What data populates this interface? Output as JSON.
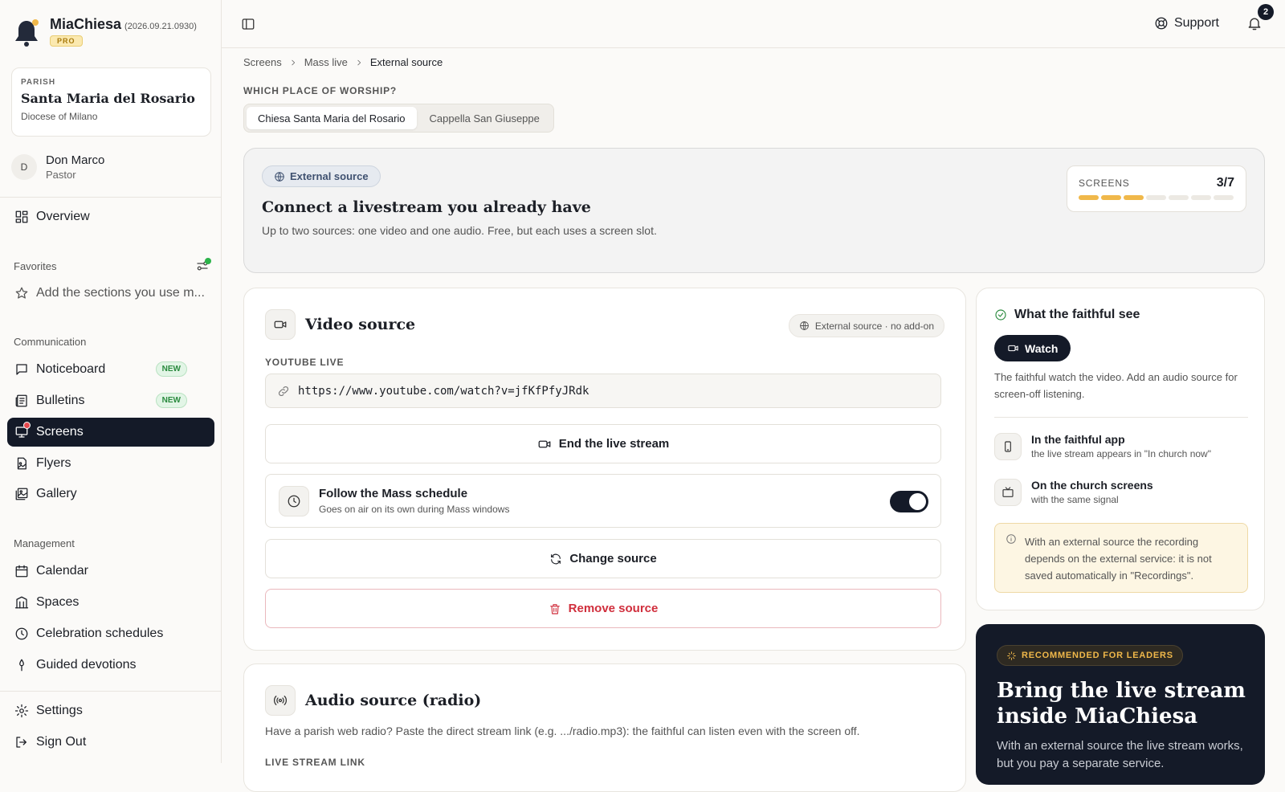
{
  "app": {
    "name": "MiaChiesa",
    "version": "(2026.09.21.0930)",
    "plan": "PRO"
  },
  "parish": {
    "label": "PARISH",
    "name": "Santa Maria del Rosario",
    "diocese": "Diocese of Milano"
  },
  "user": {
    "initial": "D",
    "name": "Don Marco",
    "role": "Pastor"
  },
  "nav": {
    "overview": "Overview",
    "favorites_title": "Favorites",
    "favorites_hint": "Add the sections you use m...",
    "communication_title": "Communication",
    "noticeboard": "Noticeboard",
    "bulletins": "Bulletins",
    "new_badge": "NEW",
    "screens": "Screens",
    "flyers": "Flyers",
    "gallery": "Gallery",
    "management_title": "Management",
    "calendar": "Calendar",
    "spaces": "Spaces",
    "celebration": "Celebration schedules",
    "devotions": "Guided devotions",
    "settings": "Settings",
    "signout": "Sign Out"
  },
  "topbar": {
    "support": "Support",
    "notifications": "2"
  },
  "breadcrumb": [
    "Screens",
    "Mass live",
    "External source"
  ],
  "worship": {
    "label": "WHICH PLACE OF WORSHIP?",
    "options": [
      "Chiesa Santa Maria del Rosario",
      "Cappella San Giuseppe"
    ],
    "selected": "Chiesa Santa Maria del Rosario"
  },
  "hero": {
    "chip": "External source",
    "title": "Connect a livestream you already have",
    "desc": "Up to two sources: one video and one audio. Free, but each uses a screen slot.",
    "screens_label": "SCREENS",
    "screens_value": "3/7",
    "screens_used": 3,
    "screens_total": 7
  },
  "video": {
    "title": "Video source",
    "pill": "External source · no add-on",
    "field_label": "YOUTUBE LIVE",
    "url": "https://www.youtube.com/watch?v=jfKfPfyJRdk",
    "end_button": "End the live stream",
    "follow_title": "Follow the Mass schedule",
    "follow_sub": "Goes on air on its own during Mass windows",
    "follow_on": true,
    "change_button": "Change source",
    "remove_button": "Remove source"
  },
  "audio": {
    "title": "Audio source (radio)",
    "desc": "Have a parish web radio? Paste the direct stream link (e.g. .../radio.mp3): the faithful can listen even with the screen off.",
    "field_label": "LIVE STREAM LINK"
  },
  "faithful": {
    "title": "What the faithful see",
    "watch": "Watch",
    "desc": "The faithful watch the video. Add an audio source for screen-off listening.",
    "app_title": "In the faithful app",
    "app_sub": "the live stream appears in \"In church now\"",
    "screens_title": "On the church screens",
    "screens_sub": "with the same signal",
    "note": "With an external source the recording depends on the external service: it is not saved automatically in \"Recordings\"."
  },
  "promo": {
    "badge": "RECOMMENDED FOR LEADERS",
    "title": "Bring the live stream inside MiaChiesa",
    "desc": "With an external source the live stream works, but you pay a separate service."
  },
  "colors": {
    "accent": "#141a28",
    "gold": "#f0b84a",
    "danger": "#d02e3c",
    "success": "#2a8a3e"
  }
}
